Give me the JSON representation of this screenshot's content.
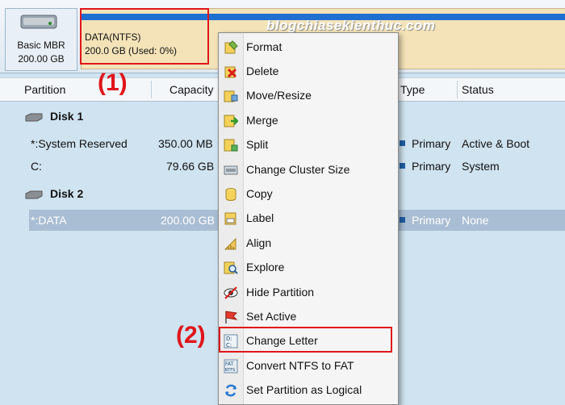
{
  "disk_map": {
    "disk_tile": {
      "line1": "Basic MBR",
      "line2": "200.00 GB"
    },
    "partition": {
      "name": "DATA(NTFS)",
      "size": "200.0 GB (Used: 0%)"
    }
  },
  "watermark": "blogchiasekienthuc.com",
  "annotations": {
    "step1": "(1)",
    "step2": "(2)"
  },
  "table": {
    "headers": {
      "partition": "Partition",
      "capacity": "Capacity",
      "type": "Type",
      "status": "Status"
    },
    "disks": [
      {
        "name": "Disk 1"
      },
      {
        "name": "Disk 2"
      }
    ],
    "rows": [
      {
        "partition": "*:System Reserved",
        "capacity": "350.00 MB",
        "type": "Primary",
        "status": "Active & Boot"
      },
      {
        "partition": "C:",
        "capacity": "79.66 GB",
        "type": "Primary",
        "status": "System"
      },
      {
        "partition": "*:DATA",
        "capacity": "200.00 GB",
        "type": "Primary",
        "status": "None"
      }
    ]
  },
  "context_menu": {
    "items": [
      {
        "label": "Format",
        "icon": "format-icon"
      },
      {
        "label": "Delete",
        "icon": "delete-icon"
      },
      {
        "label": "Move/Resize",
        "icon": "move-resize-icon"
      },
      {
        "label": "Merge",
        "icon": "merge-icon"
      },
      {
        "label": "Split",
        "icon": "split-icon"
      },
      {
        "label": "Change Cluster Size",
        "icon": "cluster-size-icon"
      },
      {
        "label": "Copy",
        "icon": "copy-icon"
      },
      {
        "label": "Label",
        "icon": "label-icon"
      },
      {
        "label": "Align",
        "icon": "align-icon"
      },
      {
        "label": "Explore",
        "icon": "explore-icon"
      },
      {
        "label": "Hide Partition",
        "icon": "hide-partition-icon"
      },
      {
        "label": "Set Active",
        "icon": "set-active-flag-icon"
      },
      {
        "label": "Change Letter",
        "icon": "change-letter-icon"
      },
      {
        "label": "Convert NTFS to FAT",
        "icon": "convert-fat-icon"
      },
      {
        "label": "Set Partition as Logical",
        "icon": "set-logical-icon"
      }
    ]
  },
  "colors": {
    "highlight": "#e0151b",
    "usage_bar": "#1f6fd0",
    "partition_block": "#f4e3b8",
    "selected_row": "#a9bdd3"
  }
}
